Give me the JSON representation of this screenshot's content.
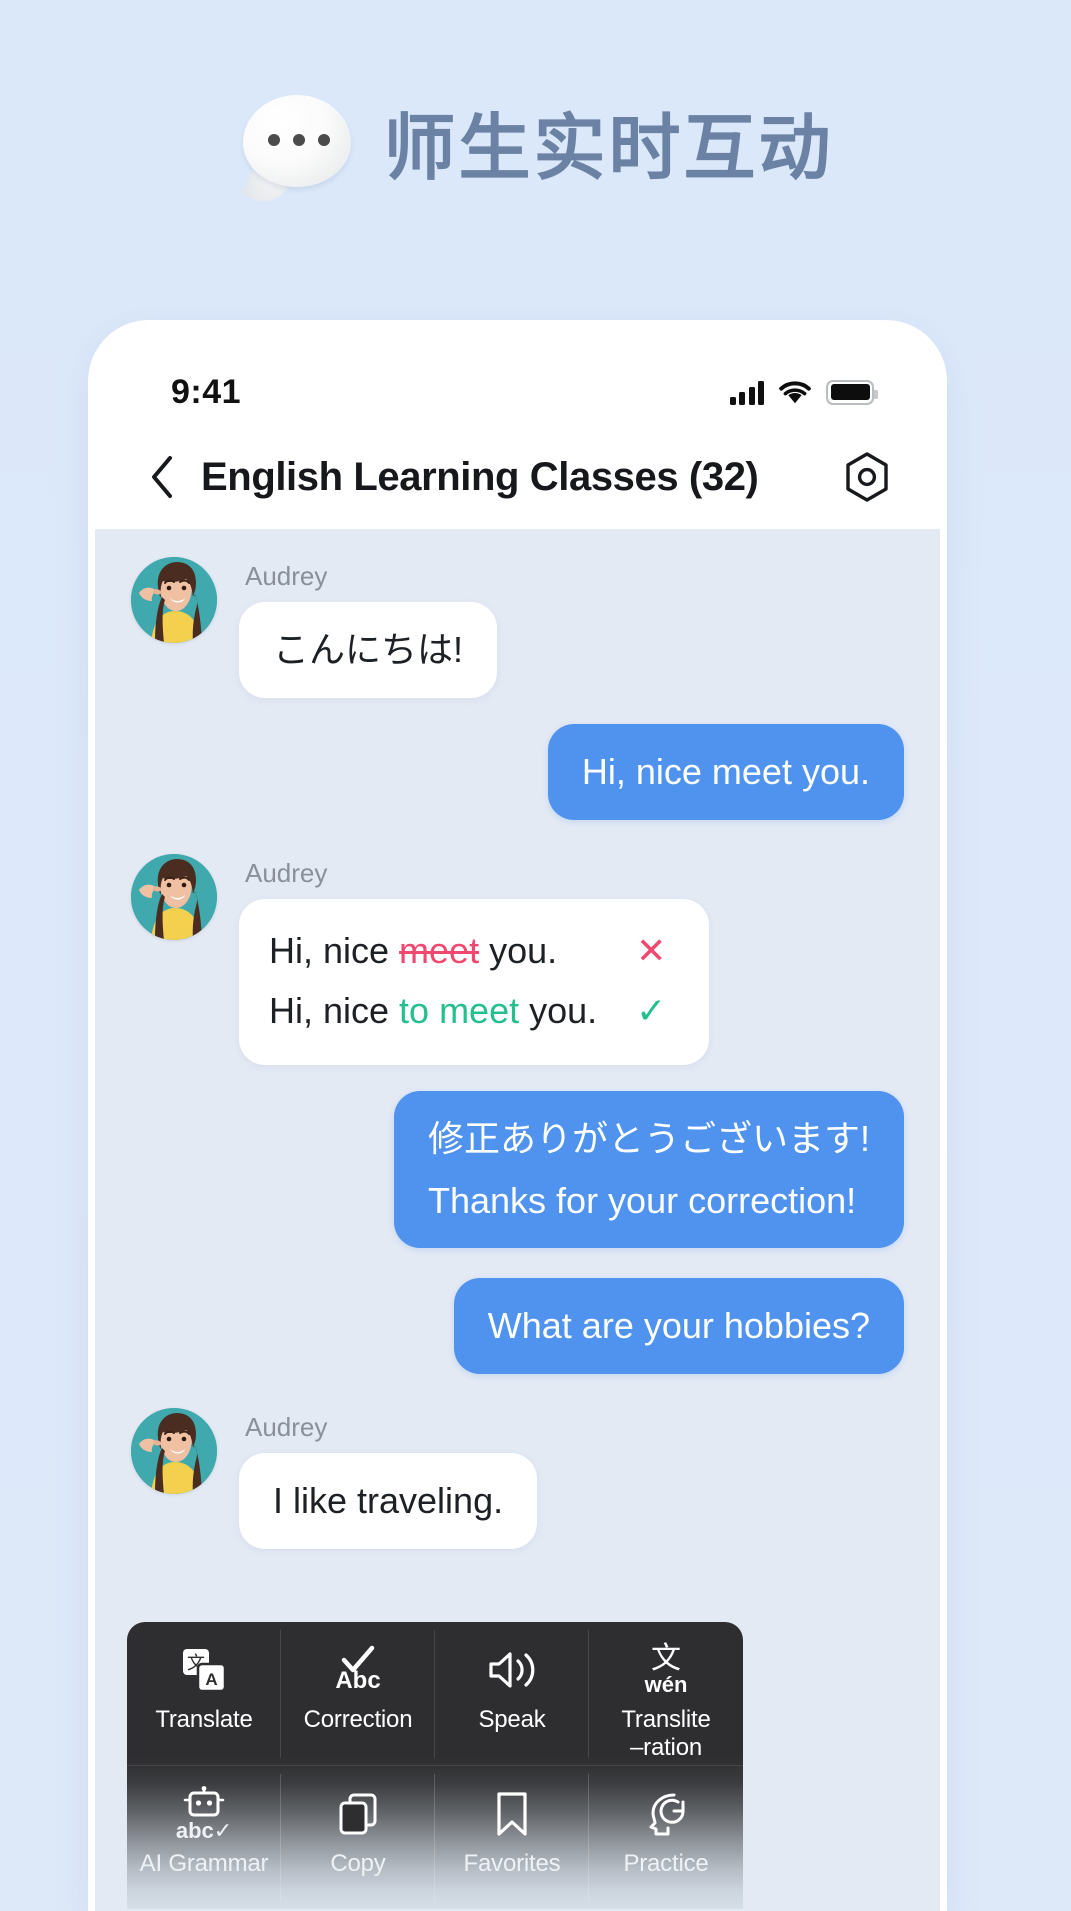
{
  "promo": {
    "icon": "speech-balloon-icon",
    "title": "师生实时互动"
  },
  "phone": {
    "status": {
      "time": "9:41",
      "signal_icon": "cellular-signal-icon",
      "wifi_icon": "wifi-icon",
      "battery_icon": "battery-full-icon"
    },
    "nav": {
      "back_icon": "chevron-left-icon",
      "title": "English Learning Classes (32)",
      "settings_icon": "hexagon-settings-icon"
    }
  },
  "chat": {
    "sender_name": "Audrey",
    "messages": [
      {
        "id": "m1",
        "side": "left",
        "sender": "Audrey",
        "type": "text",
        "text": "こんにちは!"
      },
      {
        "id": "m2",
        "side": "right",
        "type": "text",
        "text": "Hi, nice meet you."
      },
      {
        "id": "m3",
        "side": "left",
        "sender": "Audrey",
        "type": "correction",
        "wrong": {
          "prefix": "Hi, nice ",
          "strike": "meet",
          "suffix": " you.",
          "mark": "✕",
          "mark_color": "#f0486e"
        },
        "right": {
          "prefix": "Hi, nice ",
          "fixed": "to meet",
          "suffix": " you.",
          "mark": "✓",
          "mark_color": "#23c08a"
        }
      },
      {
        "id": "m4",
        "side": "right",
        "type": "dual",
        "primary": "修正ありがとうございます!",
        "secondary": "Thanks for your correction!"
      },
      {
        "id": "m5",
        "side": "right",
        "type": "text",
        "text": "What are your hobbies?"
      },
      {
        "id": "m6",
        "side": "left",
        "sender": "Audrey",
        "type": "text",
        "text": "I like traveling."
      }
    ]
  },
  "action_menu": {
    "row1": [
      {
        "icon": "translate-icon",
        "label": "Translate"
      },
      {
        "icon": "correction-abc-icon",
        "label": "Correction"
      },
      {
        "icon": "speaker-icon",
        "label": "Speak"
      },
      {
        "icon": "transliteration-icon",
        "label": "Translite\n–ration"
      }
    ],
    "row2": [
      {
        "icon": "ai-robot-grammar-icon",
        "label": "AI Grammar"
      },
      {
        "icon": "copy-icon",
        "label": "Copy"
      },
      {
        "icon": "bookmark-icon",
        "label": "Favorites"
      },
      {
        "icon": "practice-head-icon",
        "label": "Practice"
      }
    ],
    "transliteration_glyph": "文",
    "transliteration_pinyin": "wén",
    "correction_glyph": "Abc",
    "grammar_glyph": "abc✓"
  },
  "colors": {
    "page_bg": "#dce9fa",
    "promo_text": "#6b82a4",
    "bubble_blue": "#4f93ee",
    "bubble_white": "#ffffff",
    "chat_bg": "#e4eaf4",
    "error_red": "#f0486e",
    "ok_green": "#23c08a",
    "menu_dark": "#2e2e30",
    "avatar_bg": "#3fa9ad"
  }
}
